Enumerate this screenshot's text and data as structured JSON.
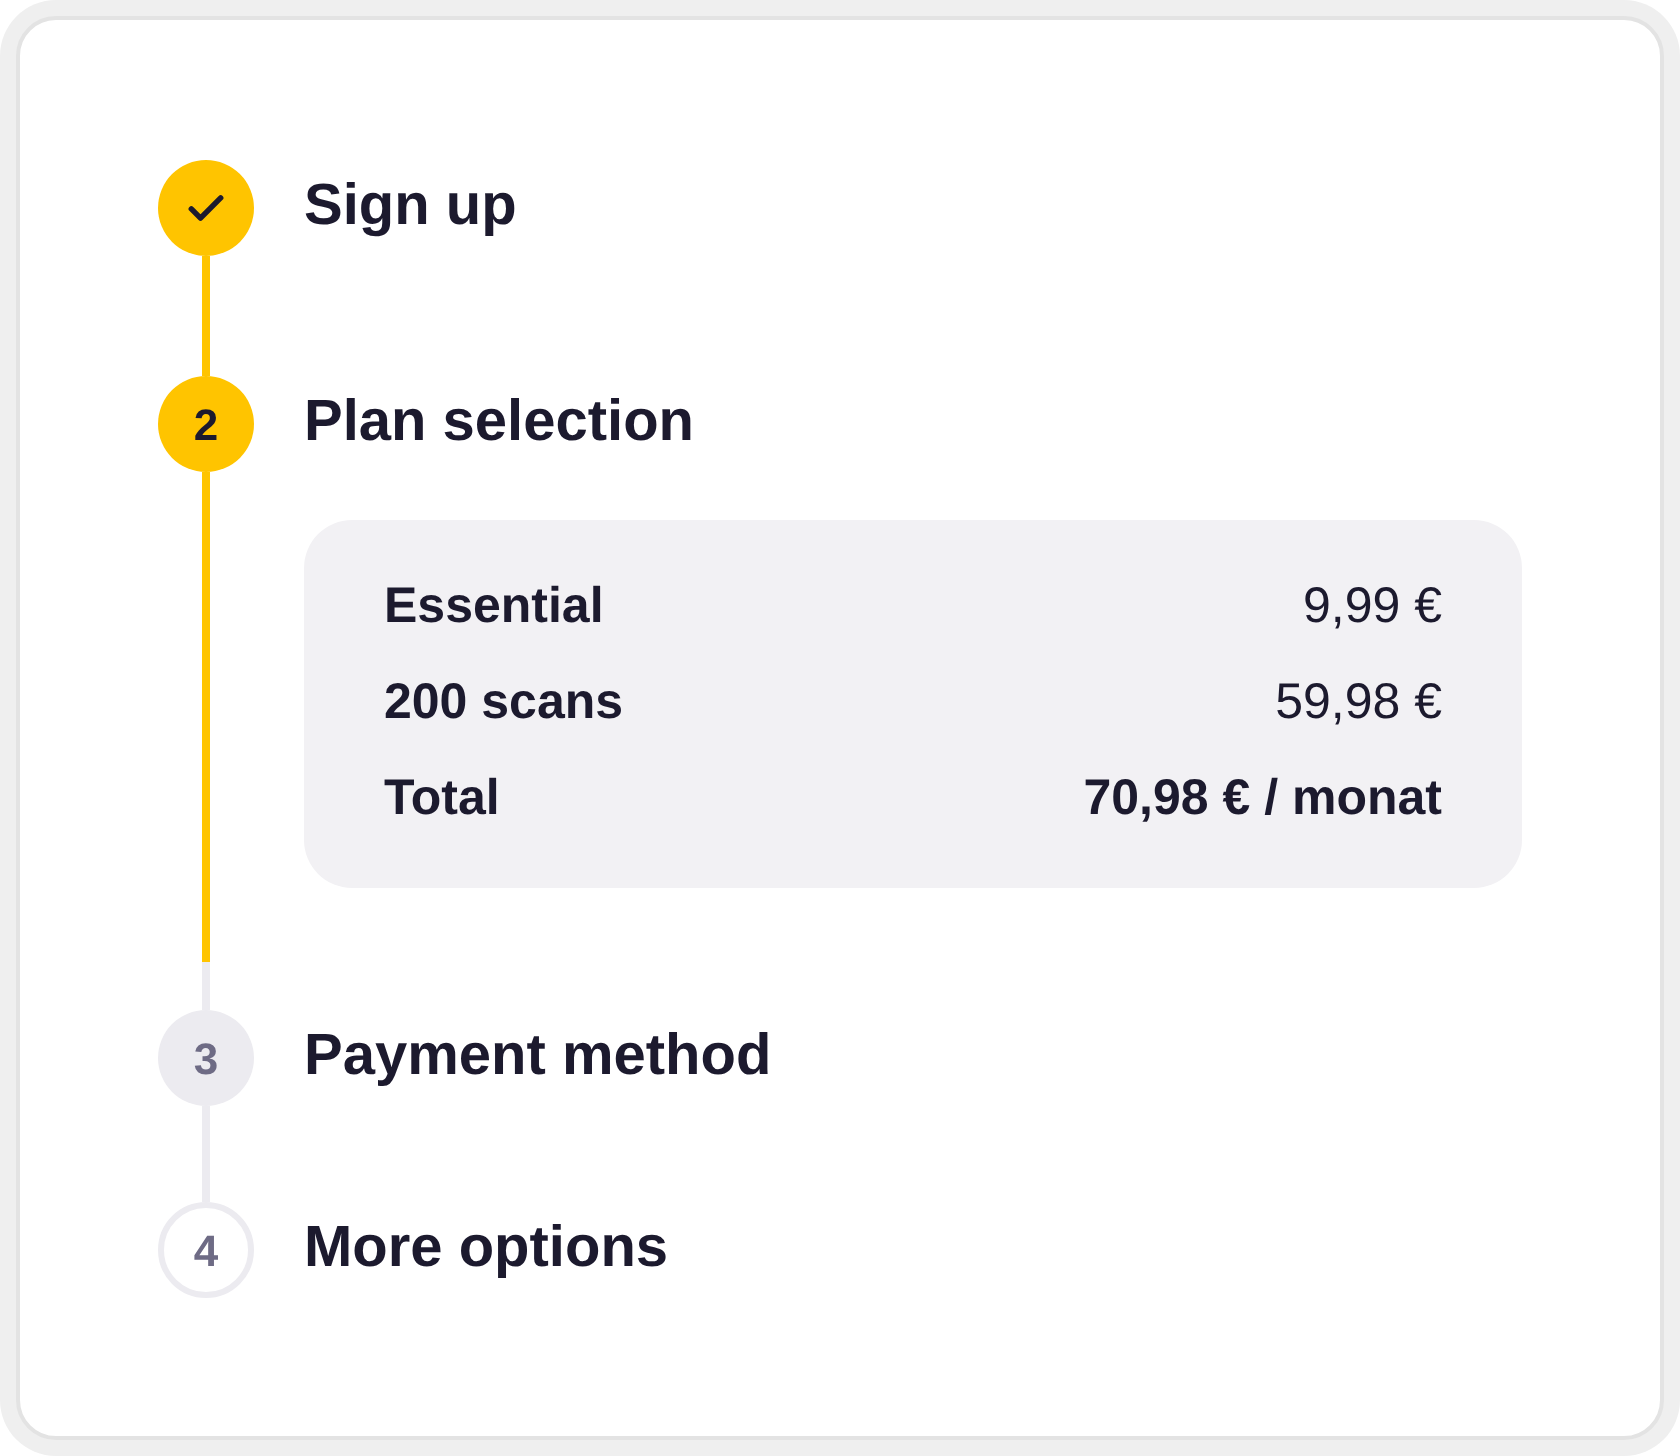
{
  "steps": [
    {
      "label": "Sign up",
      "completed": true,
      "current": false,
      "disabled": false
    },
    {
      "number": "2",
      "label": "Plan selection",
      "completed": false,
      "current": true,
      "disabled": false,
      "summary": {
        "rows": [
          {
            "kind": "item",
            "label": "Essential",
            "value": "9,99 €"
          },
          {
            "kind": "item",
            "label": "200 scans",
            "value": "59,98 €"
          },
          {
            "kind": "total",
            "label": "Total",
            "value": "70,98 € / monat"
          }
        ]
      }
    },
    {
      "number": "3",
      "label": "Payment method",
      "completed": false,
      "current": false,
      "disabled": false
    },
    {
      "number": "4",
      "label": "More options",
      "completed": false,
      "current": false,
      "disabled": true
    }
  ]
}
